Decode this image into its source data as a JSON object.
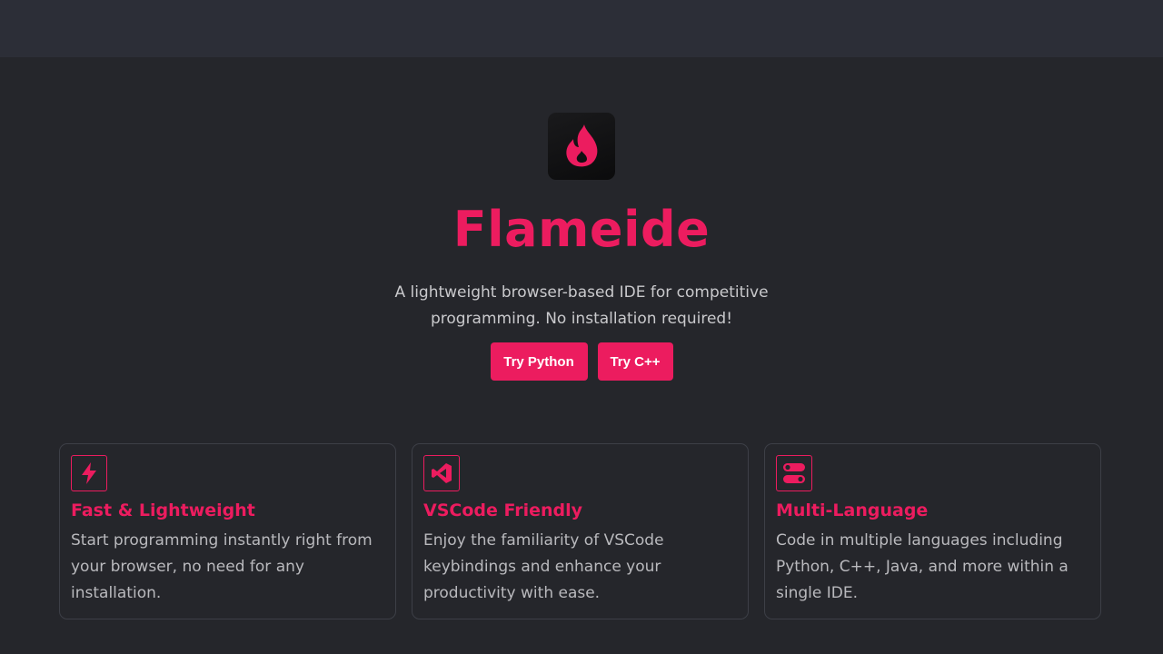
{
  "app": {
    "name": "Flameide",
    "tagline": "A lightweight browser-based IDE for competitive programming. No installation required!"
  },
  "buttons": {
    "try_python": "Try Python",
    "try_cpp": "Try C++"
  },
  "features": [
    {
      "icon": "lightning-icon",
      "title": "Fast & Lightweight",
      "text": "Start programming instantly right from your browser, no need for any installation."
    },
    {
      "icon": "vscode-icon",
      "title": "VSCode Friendly",
      "text": "Enjoy the familiarity of VSCode keybindings and enhance your productivity with ease."
    },
    {
      "icon": "toggle-icon",
      "title": "Multi-Language",
      "text": "Code in multiple languages including Python, C++, Java, and more within a single IDE."
    }
  ],
  "colors": {
    "accent": "#ec1c5f",
    "background": "#25262b",
    "topbar": "#2c2e37"
  }
}
